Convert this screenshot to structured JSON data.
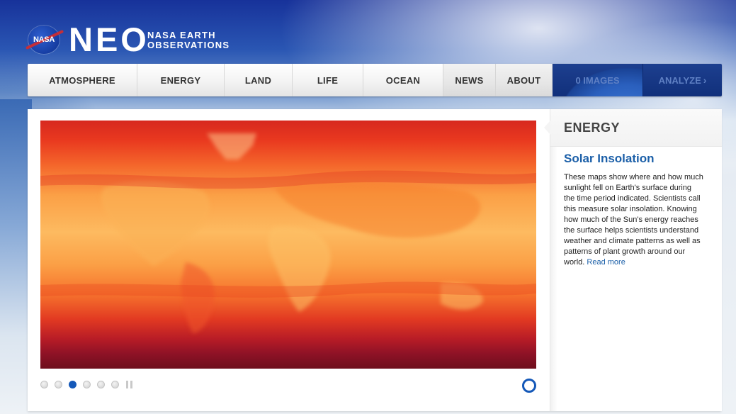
{
  "header": {
    "logo_badge": "NASA",
    "logo_title": "NEO",
    "logo_subtitle_line1": "NASA EARTH",
    "logo_subtitle_line2": "OBSERVATIONS"
  },
  "nav": {
    "items": [
      {
        "label": "ATMOSPHERE"
      },
      {
        "label": "ENERGY"
      },
      {
        "label": "LAND"
      },
      {
        "label": "LIFE"
      },
      {
        "label": "OCEAN"
      },
      {
        "label": "NEWS"
      },
      {
        "label": "ABOUT"
      }
    ],
    "images_label": "0 IMAGES",
    "analyze_label": "ANALYZE"
  },
  "slideshow": {
    "total_slides": 6,
    "active_slide": 3,
    "map_colors": [
      "#6e0e1c",
      "#a4172a",
      "#d7281f",
      "#ee4c22",
      "#f6722d",
      "#fba046",
      "#fdc166"
    ]
  },
  "sidebar": {
    "category": "ENERGY",
    "title": "Solar Insolation",
    "description": "These maps show where and how much sunlight fell on Earth's surface during the time period indicated. Scientists call this measure solar insolation. Knowing how much of the Sun's energy reaches the surface helps scientists understand weather and climate patterns as well as patterns of plant growth around our world.",
    "read_more": "Read more"
  }
}
